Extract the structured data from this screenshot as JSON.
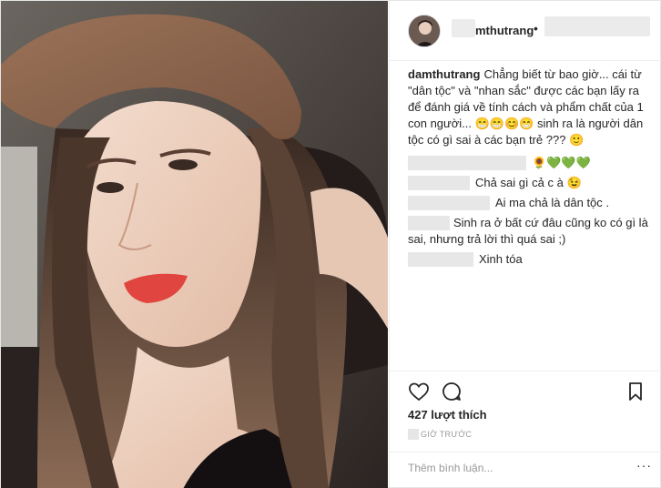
{
  "post": {
    "username": "damthutrang",
    "header_username_visible": "mthutrang",
    "header_dot": "•",
    "caption_username": "damthutrang",
    "caption_text": "Chẳng biết từ bao giờ... cái từ \"dân tộc\" và \"nhan sắc\" được các bạn lấy ra để đánh giá về tính cách và phẩm chất của 1 con người... 😁😁😊😁 sinh ra là người dân tộc có gì sai à các bạn trẻ ??? 🙂"
  },
  "comments": [
    {
      "text": "🌻💚💚💚"
    },
    {
      "text": "Chả sai gì cả c à 😉"
    },
    {
      "text": "Ai ma chả là dân tộc ."
    },
    {
      "text": "Sinh ra ở bất cứ đâu cũng ko có gì là sai, nhưng trả lời thì quá sai ;)"
    },
    {
      "text": "Xinh tóa"
    }
  ],
  "actions": {
    "like_icon": "heart-icon",
    "comment_icon": "comment-icon",
    "save_icon": "bookmark-icon",
    "likes_text": "427 lượt thích",
    "time_text": "GIỜ TRƯỚC"
  },
  "add_comment": {
    "placeholder": "Thêm bình luận...",
    "more_label": "···"
  }
}
